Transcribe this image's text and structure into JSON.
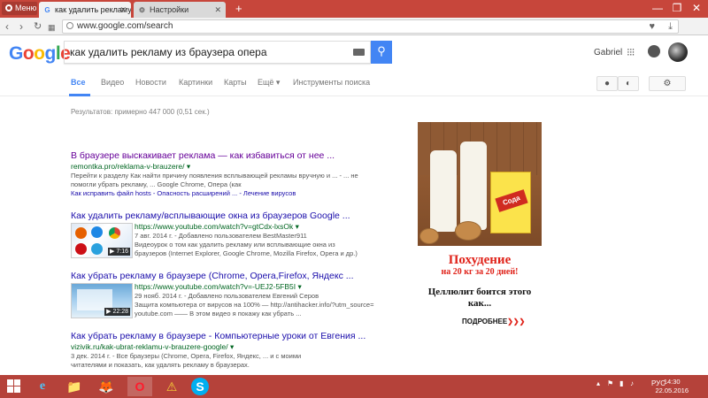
{
  "browser": {
    "menu_label": "Меню",
    "tabs": [
      {
        "title": "как удалить рекламу из б",
        "favicon": "G"
      },
      {
        "title": "Настройки",
        "favicon": "⚙"
      }
    ],
    "new_tab": "+",
    "window_controls": [
      "—",
      "❐",
      "✕"
    ],
    "address": "www.google.com/search"
  },
  "google": {
    "logo": [
      "G",
      "o",
      "o",
      "g",
      "l",
      "e"
    ],
    "query": "как удалить рекламу из браузера опера",
    "user_name": "Gabriel",
    "tabs": [
      "Все",
      "Видео",
      "Новости",
      "Картинки",
      "Карты",
      "Ещё ▾",
      "Инструменты поиска"
    ],
    "stats": "Результатов: примерно 447 000 (0,51 сек.)"
  },
  "results": [
    {
      "title": "В браузере выскакивает реклама — как избавиться от нее ...",
      "url": "remontka.pro/reklama-v-brauzere/ ▾",
      "snippet_lines": [
        "Перейти к разделу Как найти причину появления всплывающей рекламы вручную и ... - ... не",
        "помогли убрать рекламу, ... Google Chrome, Опера (как"
      ],
      "links": "Как исправить файл hosts - Опасность расширений ... - Лечение вирусов"
    },
    {
      "title": "Как удалить рекламу/всплывающие окна из браузеров Google ...",
      "url": "https://www.youtube.com/watch?v=gtCdx-lxsOk ▾",
      "meta": "7 авг. 2014 г. - Добавлено пользователем BestMaster911",
      "snippet_lines": [
        "Видеоурок о том как удалить рекламу или всплывающие окна из",
        "браузеров (Internet Explorer, Google Chrome, Mozilla Firefox, Opera и др.)"
      ],
      "duration": "▶ 7:16"
    },
    {
      "title": "Как убрать рекламу в браузере (Chrome, Opera,Firefox, Яндекс ...",
      "url": "https://www.youtube.com/watch?v=-UEJ2-5FB5I ▾",
      "meta": "29 нояб. 2014 г. - Добавлено пользователем Евгений Серов",
      "snippet_lines": [
        "Защита компьютера от вирусов на 100% — http://antihacker.info/?utm_source=",
        "youtube.com —— В этом видео я покажу как убрать ..."
      ],
      "duration": "▶ 22:28"
    },
    {
      "title": "Как убрать рекламу в браузере - Компьютерные уроки от Евгения ...",
      "url": "vizivik.ru/kak-ubrat-reklamu-v-brauzere-google/ ▾",
      "snippet_lines": [
        "3 дек. 2014 г. - Все браузеры (Chrome, Opera, Firefox, Яндекс, ... и с моими",
        "читателями и показать, как удалять рекламу в браузерах."
      ]
    }
  ],
  "ad": {
    "box_label": "Сода",
    "headline": "Похудение",
    "subheadline": "на 20 кг за 20 дней!",
    "text": "Целлюлит боится этого как...",
    "more": "ПОДРОБНЕЕ",
    "more_arrows": "❯❯❯"
  },
  "taskbar": {
    "apps": [
      "e",
      "📁",
      "🦊",
      "O",
      "⚠",
      "S"
    ],
    "lang": "РУС",
    "time": "14:30",
    "date": "22.05.2016"
  },
  "colors": {
    "accent": "#4285f4",
    "link": "#1a0dab",
    "visited": "#660099",
    "url": "#006621",
    "chrome": "#c7463b"
  }
}
